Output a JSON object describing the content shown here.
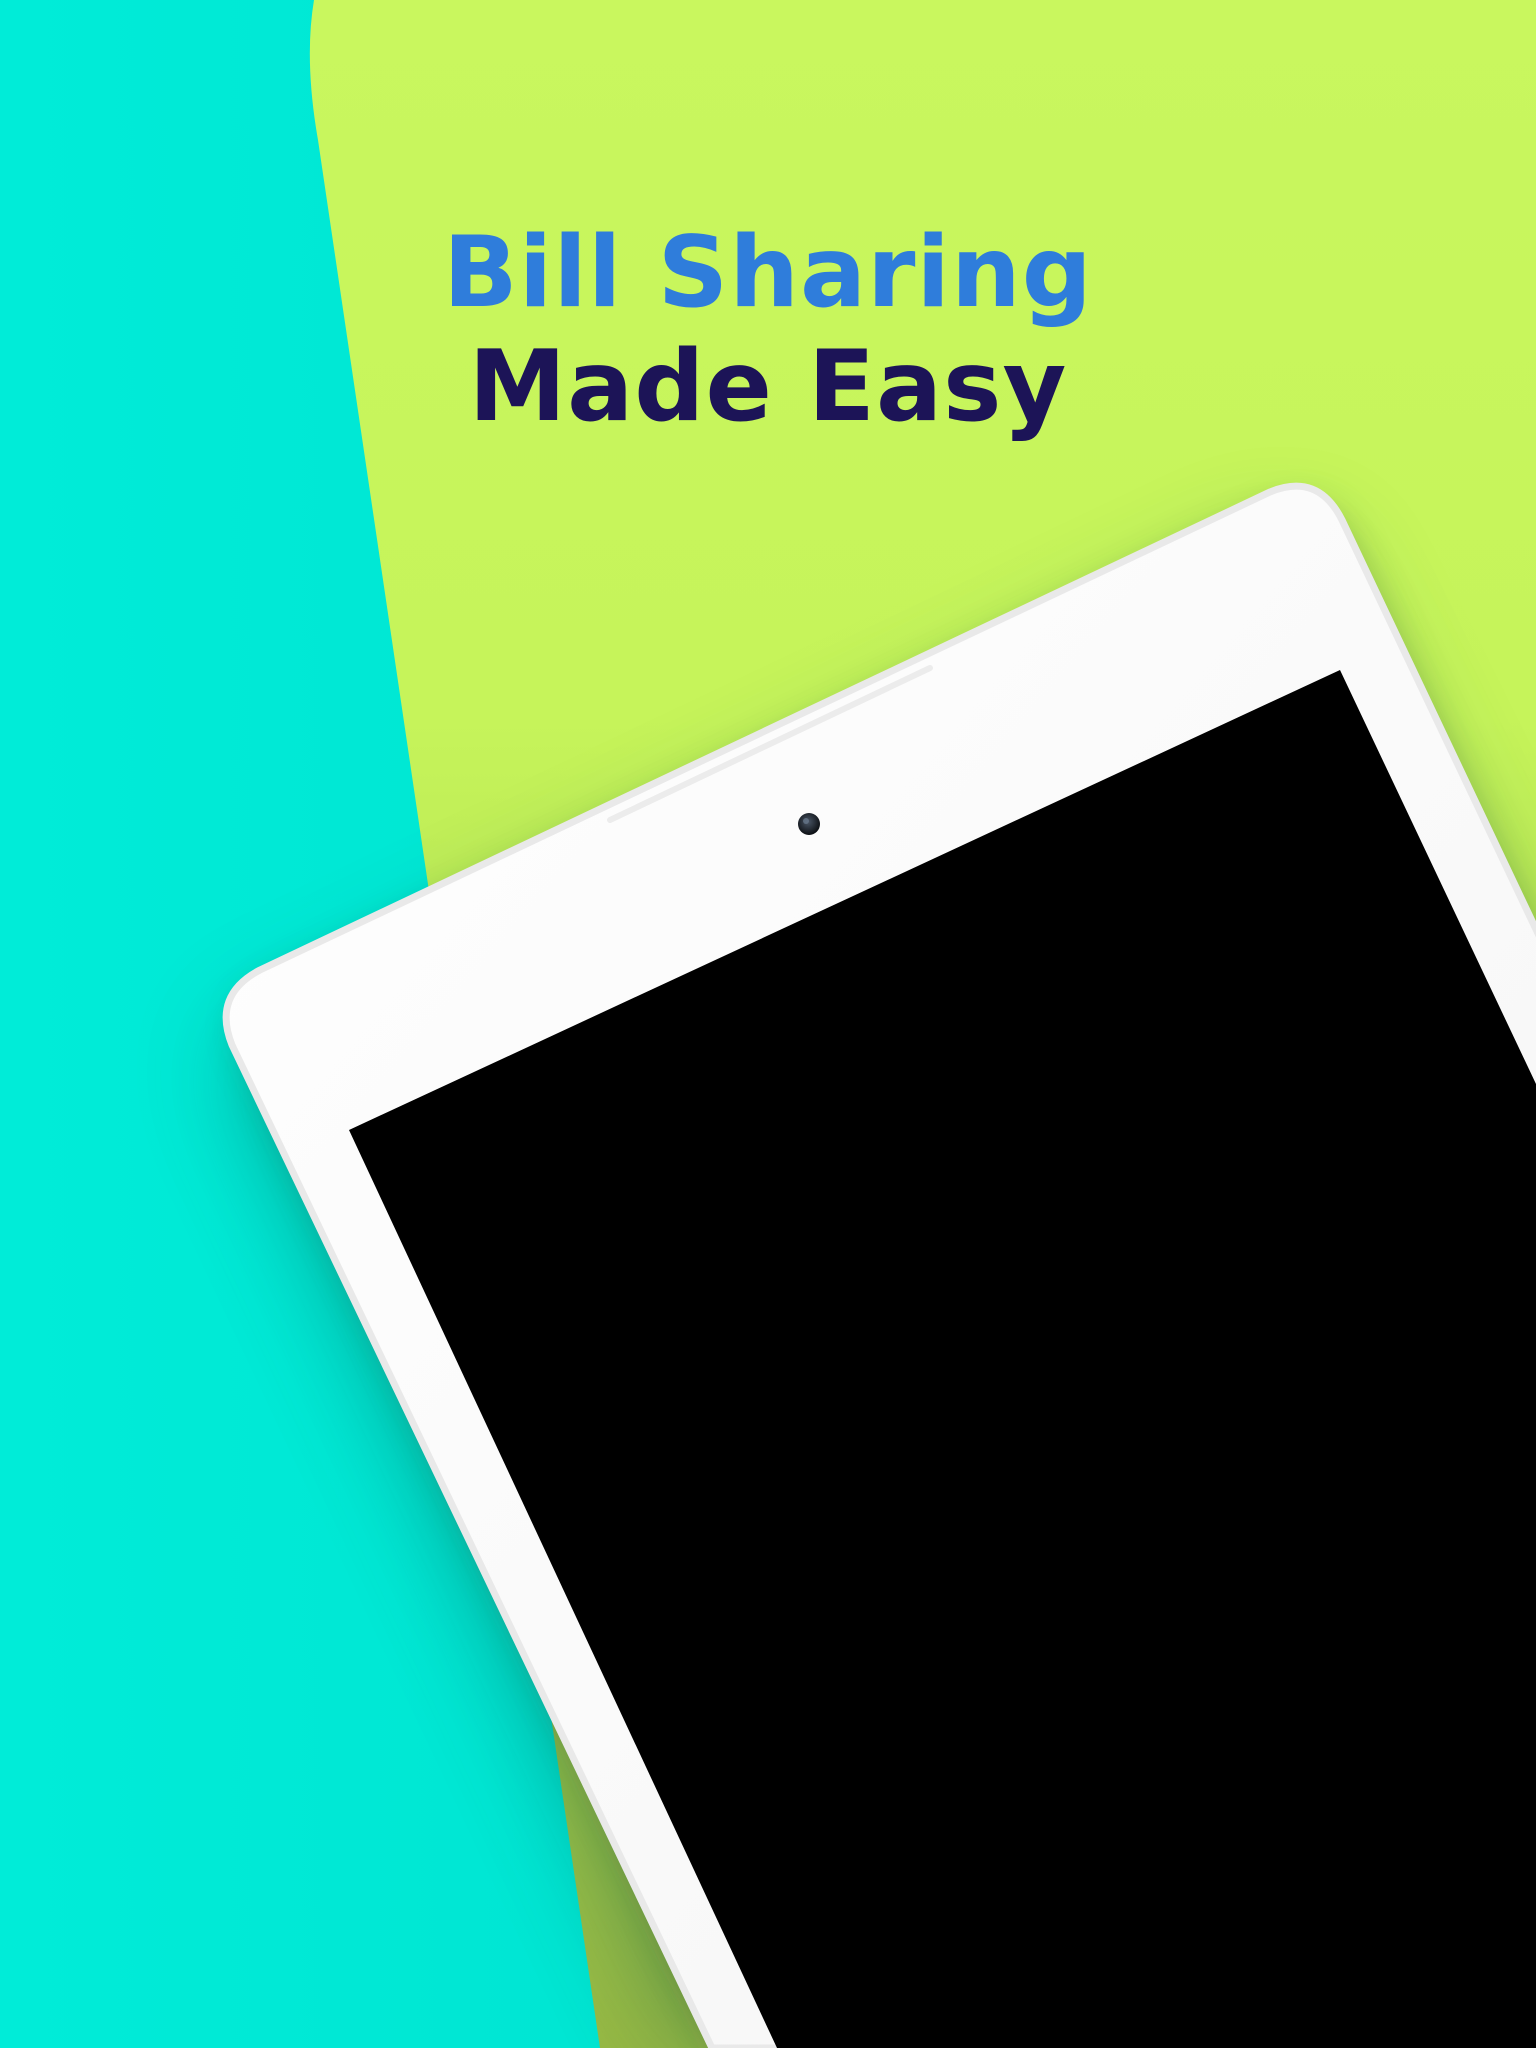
{
  "headline": {
    "line_1": "Bill Sharing",
    "line_2": "Made Easy"
  },
  "colors": {
    "background_left": "#00e8d6",
    "background_right": "#c8f55c",
    "headline_line_1": "#2f7ddb",
    "headline_line_2": "#1c1457",
    "device_frame": "#fbfbfb",
    "device_screen": "#000000"
  },
  "icons": {
    "front_camera": "camera-dot-icon"
  }
}
